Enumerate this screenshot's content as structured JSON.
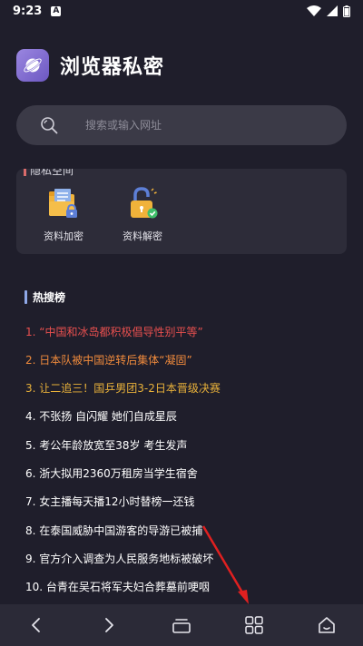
{
  "status_bar": {
    "time": "9:23",
    "notif_letter": "A"
  },
  "header": {
    "title": "浏览器私密"
  },
  "search": {
    "placeholder": "搜索或输入网址"
  },
  "privacy_card": {
    "title": "隐私空间",
    "tools": [
      {
        "label": "资料加密"
      },
      {
        "label": "资料解密"
      }
    ]
  },
  "hot_list": {
    "title": "热搜榜",
    "items": [
      {
        "text": "1. “中国和冰岛都积极倡导性别平等”",
        "color": "#e8504f"
      },
      {
        "text": "2. 日本队被中国逆转后集体“凝固”",
        "color": "#ef8a3c"
      },
      {
        "text": "3. 让二追三！国乒男团3-2日本晋级决赛",
        "color": "#e8b13a"
      },
      {
        "text": "4. 不张扬 自闪耀 她们自成星辰",
        "color": "#ffffff"
      },
      {
        "text": "5. 考公年龄放宽至38岁 考生发声",
        "color": "#ffffff"
      },
      {
        "text": "6. 浙大拟用2360万租房当学生宿舍",
        "color": "#ffffff"
      },
      {
        "text": "7. 女主播每天播12小时替榜一还钱",
        "color": "#ffffff"
      },
      {
        "text": "8. 在泰国威胁中国游客的导游已被捕",
        "color": "#ffffff"
      },
      {
        "text": "9. 官方介入调查为人民服务地标被破坏",
        "color": "#ffffff"
      },
      {
        "text": "10. 台青在吴石将军夫妇合葬墓前哽咽",
        "color": "#ffffff"
      }
    ]
  },
  "nav_bar": {
    "icons": [
      "back-icon",
      "forward-icon",
      "tabs-icon",
      "menu-grid-icon",
      "home-icon"
    ]
  },
  "colors": {
    "background": "#1f1e2b",
    "card": "#2d2c39",
    "search_bg": "#3b3a47",
    "annotation_arrow": "#e02020"
  }
}
